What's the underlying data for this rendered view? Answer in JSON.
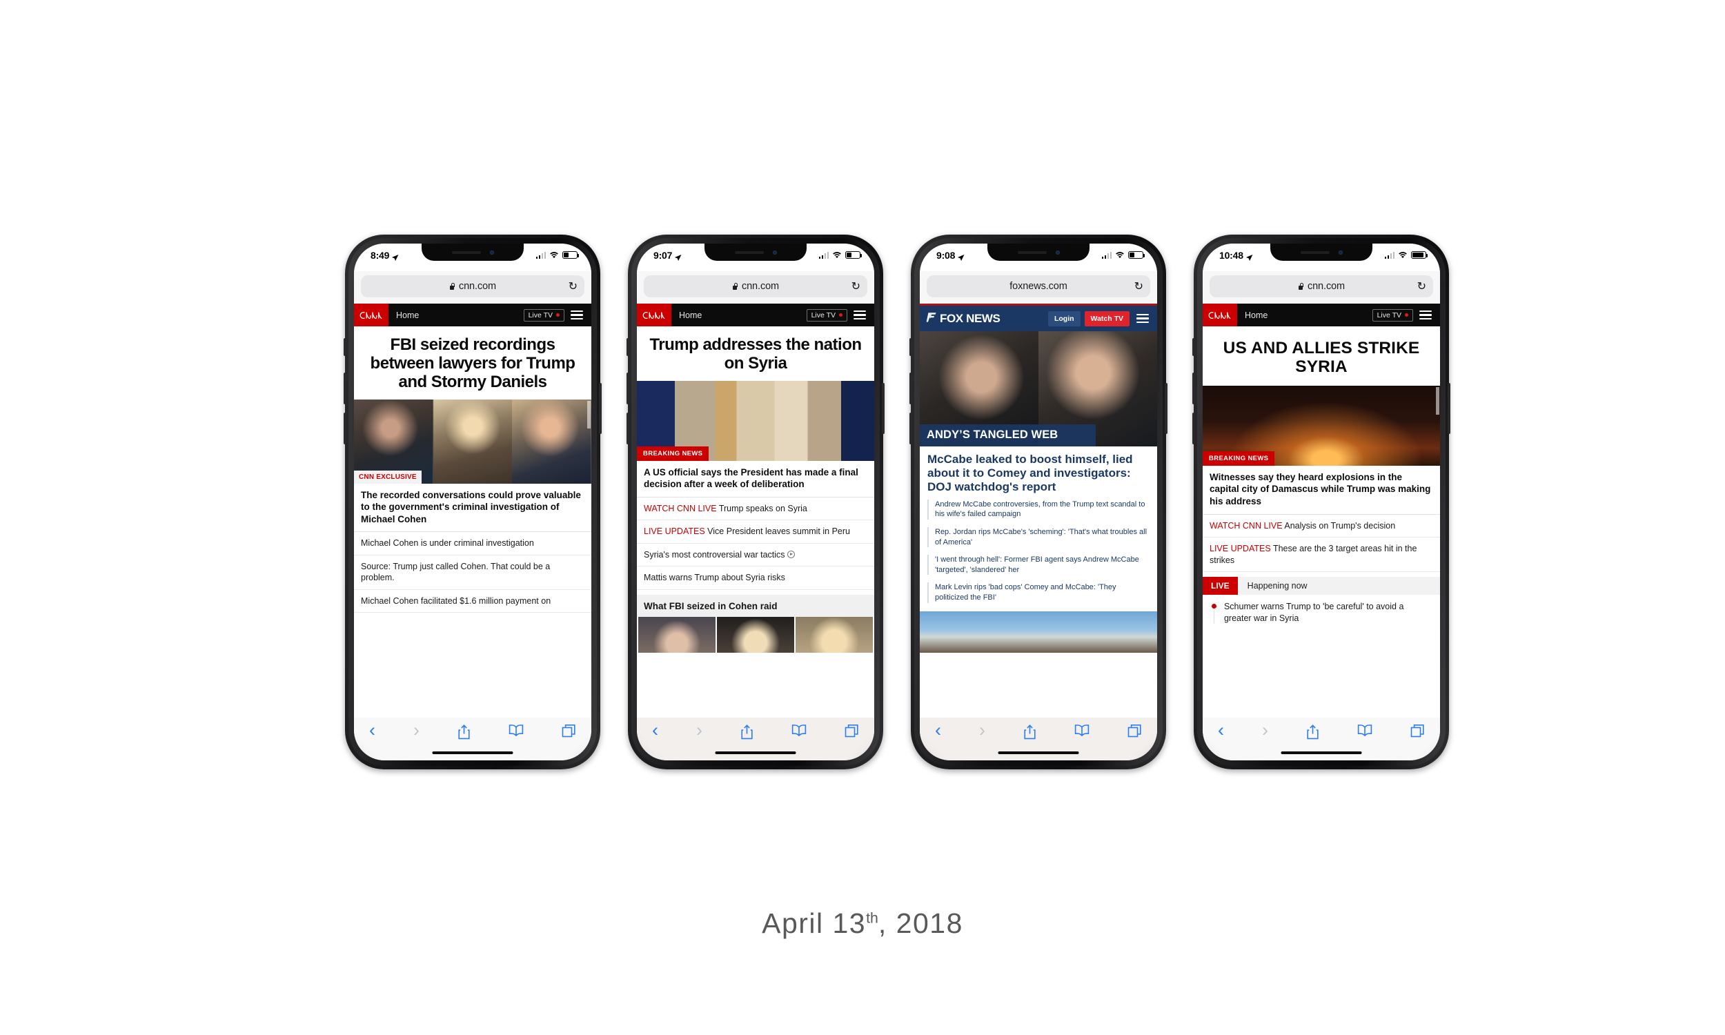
{
  "caption": {
    "month_day": "April 13",
    "ordinal": "th",
    "year": ", 2018"
  },
  "icons": {
    "lock": "lock-icon",
    "reload": "↻",
    "location_arrow": "location-arrow-icon",
    "back": "‹",
    "forward": "›",
    "share": "share-icon",
    "bookmarks": "book-icon",
    "tabs": "tabs-icon"
  },
  "phones": [
    {
      "id": "phone-1",
      "status": {
        "time": "8:49",
        "battery_pct": 38,
        "signal": "weak"
      },
      "browser": {
        "url": "cnn.com",
        "secure": true,
        "reload_label": "↻"
      },
      "site": "cnn",
      "nav": {
        "logo": "CNN",
        "home": "Home",
        "live_tv": "Live TV",
        "menu": "menu-icon"
      },
      "headline": "FBI seized recordings between lawyers for Trump and Stormy Daniels",
      "headline_caps": false,
      "hero_type": "trio",
      "hero_badge": "CNN EXCLUSIVE",
      "hero_badge_style": "exclusive",
      "subhead": "The recorded conversations could prove valuable to the government's criminal investigation of Michael Cohen",
      "stories": [
        {
          "kicker": "",
          "text": "Michael Cohen is under criminal investigation",
          "video": false
        },
        {
          "kicker": "",
          "text": "Source: Trump just called Cohen. That could be a problem.",
          "video": false
        },
        {
          "kicker": "",
          "text": "Michael Cohen facilitated $1.6 million payment on",
          "video": false
        }
      ],
      "section": null,
      "live": null,
      "toolbar_tint": false
    },
    {
      "id": "phone-2",
      "status": {
        "time": "9:07",
        "battery_pct": 38,
        "signal": "weak"
      },
      "browser": {
        "url": "cnn.com",
        "secure": true,
        "reload_label": "↻"
      },
      "site": "cnn",
      "nav": {
        "logo": "CNN",
        "home": "Home",
        "live_tv": "Live TV",
        "menu": "menu-icon"
      },
      "headline": "Trump addresses the nation on Syria",
      "headline_caps": false,
      "hero_type": "photo-podium",
      "hero_badge": "BREAKING NEWS",
      "hero_badge_style": "breaking",
      "subhead": "A US official says the President has made a final decision after a week of deliberation",
      "stories": [
        {
          "kicker": "WATCH CNN LIVE",
          "text": "Trump speaks on Syria",
          "video": false
        },
        {
          "kicker": "LIVE UPDATES",
          "text": "Vice President leaves summit in Peru",
          "video": false
        },
        {
          "kicker": "",
          "text": "Syria's most controversial war tactics",
          "video": true
        },
        {
          "kicker": "",
          "text": "Mattis warns Trump about Syria risks",
          "video": false
        }
      ],
      "section": {
        "title": "What FBI seized in Cohen raid"
      },
      "live": null,
      "toolbar_tint": true
    },
    {
      "id": "phone-3",
      "status": {
        "time": "9:08",
        "battery_pct": 38,
        "signal": "weak"
      },
      "browser": {
        "url": "foxnews.com",
        "secure": false,
        "reload_label": "↻"
      },
      "site": "fox",
      "nav": {
        "logo": "FOX NEWS",
        "login": "Login",
        "watch_tv": "Watch TV",
        "menu": "menu-icon"
      },
      "ribbon": "ANDY’S TANGLED WEB",
      "headline": "McCabe leaked to boost himself, lied about it to Comey and investigators: DOJ watchdog's report",
      "stories": [
        {
          "text": "Andrew McCabe controversies, from the Trump text scandal to his wife's failed campaign"
        },
        {
          "text": "Rep. Jordan rips McCabe's 'scheming': 'That's what troubles all of America'"
        },
        {
          "text": "'I went through hell': Former FBI agent says Andrew McCabe 'targeted', 'slandered' her"
        },
        {
          "text": "Mark Levin rips 'bad cops' Comey and McCabe: 'They politicized the FBI'"
        }
      ],
      "toolbar_tint": true
    },
    {
      "id": "phone-4",
      "status": {
        "time": "10:48",
        "battery_pct": 92,
        "signal": "weak"
      },
      "browser": {
        "url": "cnn.com",
        "secure": true,
        "reload_label": "↻"
      },
      "site": "cnn",
      "nav": {
        "logo": "CNN",
        "home": "Home",
        "live_tv": "Live TV",
        "menu": "menu-icon"
      },
      "headline": "US AND ALLIES STRIKE SYRIA",
      "headline_caps": true,
      "hero_type": "photo-damascus",
      "hero_badge": "BREAKING NEWS",
      "hero_badge_style": "breaking",
      "subhead": "Witnesses say they heard explosions in the capital city of Damascus while Trump was making his address",
      "stories": [
        {
          "kicker": "WATCH CNN LIVE",
          "text": "Analysis on Trump's decision",
          "video": false
        },
        {
          "kicker": "LIVE UPDATES",
          "text": "These are the 3 target areas hit in the strikes",
          "video": false
        }
      ],
      "section": null,
      "live": {
        "tag": "LIVE",
        "now_label": "Happening now",
        "items": [
          "Schumer warns Trump to 'be careful' to avoid a greater war in Syria"
        ]
      },
      "toolbar_tint": false
    }
  ],
  "colors": {
    "cnn_red": "#cc0000",
    "fox_navy": "#1b3864",
    "fox_red": "#e1232b",
    "safari_blue": "#2b7ef0",
    "caption_gray": "#58595b"
  }
}
